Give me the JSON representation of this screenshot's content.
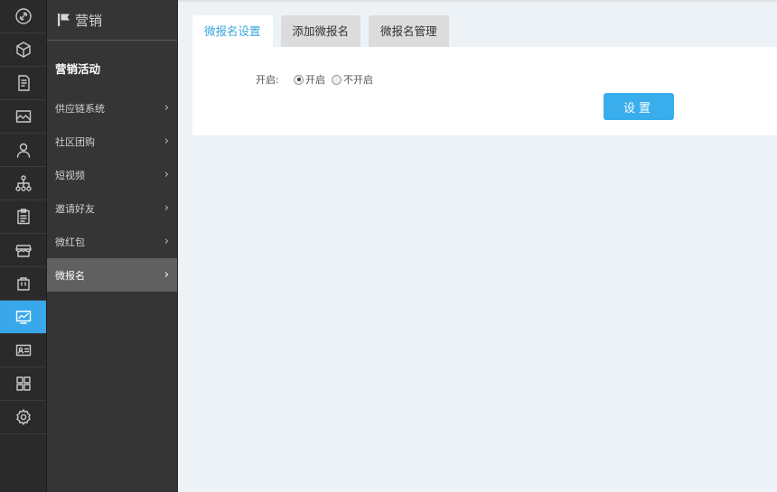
{
  "rail": {
    "items": [
      {
        "icon": "link-circle-icon",
        "active": false
      },
      {
        "icon": "box-icon",
        "active": false
      },
      {
        "icon": "document-icon",
        "active": false
      },
      {
        "icon": "image-icon",
        "active": false
      },
      {
        "icon": "user-icon",
        "active": false
      },
      {
        "icon": "org-tree-icon",
        "active": false
      },
      {
        "icon": "clipboard-icon",
        "active": false
      },
      {
        "icon": "store-icon",
        "active": false
      },
      {
        "icon": "bag-icon",
        "active": false
      },
      {
        "icon": "chart-monitor-icon",
        "active": true
      },
      {
        "icon": "id-card-icon",
        "active": false
      },
      {
        "icon": "grid-icon",
        "active": false
      },
      {
        "icon": "gear-icon",
        "active": false
      }
    ],
    "active_color": "#38a8ea"
  },
  "submenu": {
    "title": "营销",
    "group_title": "营销活动",
    "items": [
      {
        "label": "供应链系统",
        "active": false
      },
      {
        "label": "社区团购",
        "active": false
      },
      {
        "label": "短视频",
        "active": false
      },
      {
        "label": "邀请好友",
        "active": false
      },
      {
        "label": "微红包",
        "active": false
      },
      {
        "label": "微报名",
        "active": true
      }
    ],
    "chevron": "›"
  },
  "main": {
    "tabs": [
      {
        "label": "微报名设置",
        "active": true
      },
      {
        "label": "添加微报名",
        "active": false
      },
      {
        "label": "微报名管理",
        "active": false
      }
    ],
    "form": {
      "label": "开启:",
      "options": [
        {
          "label": "开启",
          "checked": true
        },
        {
          "label": "不开启",
          "checked": false
        }
      ],
      "submit_label": "设置"
    }
  },
  "colors": {
    "accent": "#3aaeed",
    "tab_active_text": "#3aa6dc",
    "sidebar_bg": "#353535",
    "rail_bg": "#2a2a2a",
    "content_bg": "#ecf2f6"
  }
}
